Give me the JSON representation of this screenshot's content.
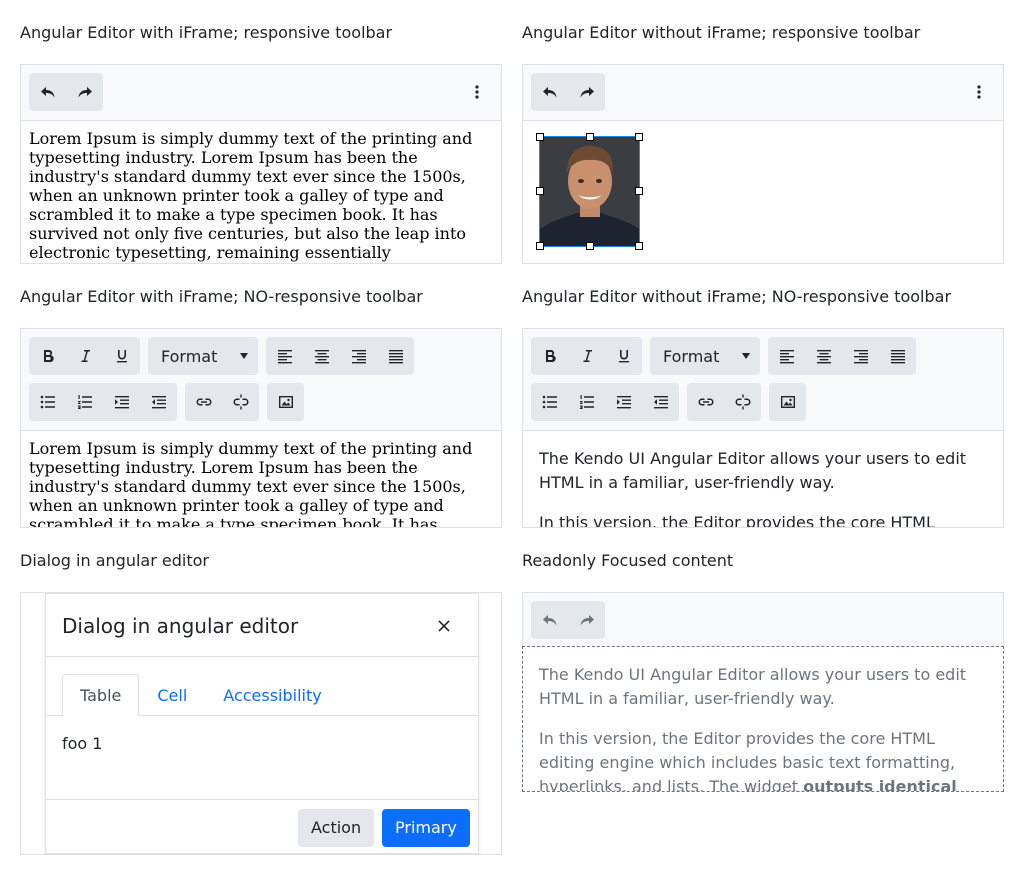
{
  "panels": {
    "p1_title": "Angular Editor with iFrame; responsive toolbar",
    "p2_title": "Angular Editor without iFrame; responsive toolbar",
    "p3_title": "Angular Editor with iFrame; NO-responsive toolbar",
    "p4_title": "Angular Editor without iFrame; NO-responsive toolbar",
    "p5_title": "Dialog in angular editor",
    "p6_title": "Readonly Focused content"
  },
  "lorem": "Lorem Ipsum is simply dummy text of the printing and typesetting industry. Lorem Ipsum has been the industry's standard dummy text ever since the 1500s, when an unknown printer took a galley of type and scrambled it to make a type specimen book. It has survived not only five centuries, but also the leap into electronic typesetting, remaining essentially",
  "kendo": {
    "para1": "The Kendo UI Angular Editor allows your users to edit HTML in a familiar, user-friendly way.",
    "para2_start": "In this version, the Editor provides the core HTML editing engine which includes basic text formatting, hyperlinks, and lists. The widget ",
    "para2_bold": "outputs identical"
  },
  "toolbar": {
    "format_label": "Format",
    "icons": [
      "undo-icon",
      "redo-icon",
      "more-vertical-icon",
      "bold-icon",
      "italic-icon",
      "underline-icon",
      "align-left-icon",
      "align-center-icon",
      "align-right-icon",
      "align-justify-icon",
      "bullet-list-icon",
      "numbered-list-icon",
      "indent-icon",
      "outdent-icon",
      "link-icon",
      "unlink-icon",
      "image-icon"
    ]
  },
  "dialog": {
    "title": "Dialog in angular editor",
    "tabs": [
      "Table",
      "Cell",
      "Accessibility"
    ],
    "body": "foo 1",
    "action_label": "Action",
    "primary_label": "Primary"
  },
  "colors": {
    "accent": "#0d6efd",
    "toolbar_bg": "#f8f9fa",
    "button_group_bg": "#e4e7eb",
    "border": "#dee2e6",
    "selection": "#1e88e5",
    "readonly_text": "#6c757d"
  }
}
